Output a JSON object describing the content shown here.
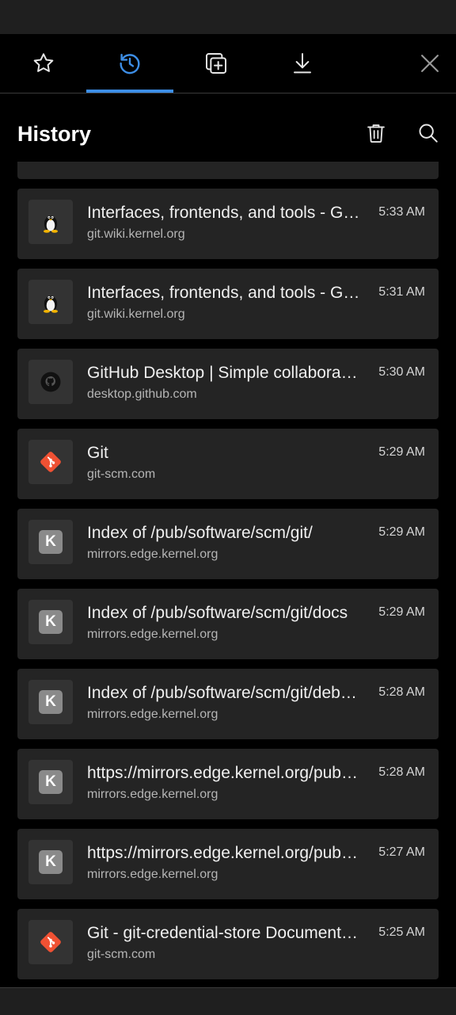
{
  "colors": {
    "accent": "#3d8ee6",
    "background": "#000000",
    "card": "#242424",
    "git_brand": "#f05133"
  },
  "tabs": [
    {
      "name": "favorites",
      "icon": "star-icon",
      "active": false
    },
    {
      "name": "history",
      "icon": "history-icon",
      "active": true
    },
    {
      "name": "collections",
      "icon": "collections-add-icon",
      "active": false
    },
    {
      "name": "downloads",
      "icon": "download-icon",
      "active": false
    }
  ],
  "header": {
    "title": "History",
    "delete_icon": "trash-icon",
    "search_icon": "search-icon"
  },
  "history": [
    {
      "title": "Interfaces, frontends, and tools - Git SCM Wiki",
      "url": "git.wiki.kernel.org",
      "time": "5:33 AM",
      "icon": "tux-icon"
    },
    {
      "title": "Interfaces, frontends, and tools - Git SCM Wiki",
      "url": "git.wiki.kernel.org",
      "time": "5:31 AM",
      "icon": "tux-icon"
    },
    {
      "title": "GitHub Desktop | Simple collaboration from your desktop",
      "url": "desktop.github.com",
      "time": "5:30 AM",
      "icon": "github-icon"
    },
    {
      "title": "Git",
      "url": "git-scm.com",
      "time": "5:29 AM",
      "icon": "git-icon"
    },
    {
      "title": "Index of /pub/software/scm/git/",
      "url": "mirrors.edge.kernel.org",
      "time": "5:29 AM",
      "icon": "kernel-k-icon",
      "letter": "K"
    },
    {
      "title": "Index of /pub/software/scm/git/docs",
      "url": "mirrors.edge.kernel.org",
      "time": "5:29 AM",
      "icon": "kernel-k-icon",
      "letter": "K"
    },
    {
      "title": "Index of /pub/software/scm/git/debian",
      "url": "mirrors.edge.kernel.org",
      "time": "5:28 AM",
      "icon": "kernel-k-icon",
      "letter": "K"
    },
    {
      "title": "https://mirrors.edge.kernel.org/pub/software/scm/git/",
      "url": "mirrors.edge.kernel.org",
      "time": "5:28 AM",
      "icon": "kernel-k-icon",
      "letter": "K"
    },
    {
      "title": "https://mirrors.edge.kernel.org/pub/software/scm/git/",
      "url": "mirrors.edge.kernel.org",
      "time": "5:27 AM",
      "icon": "kernel-k-icon",
      "letter": "K"
    },
    {
      "title": "Git - git-credential-store Documentation",
      "url": "git-scm.com",
      "time": "5:25 AM",
      "icon": "git-icon"
    }
  ]
}
